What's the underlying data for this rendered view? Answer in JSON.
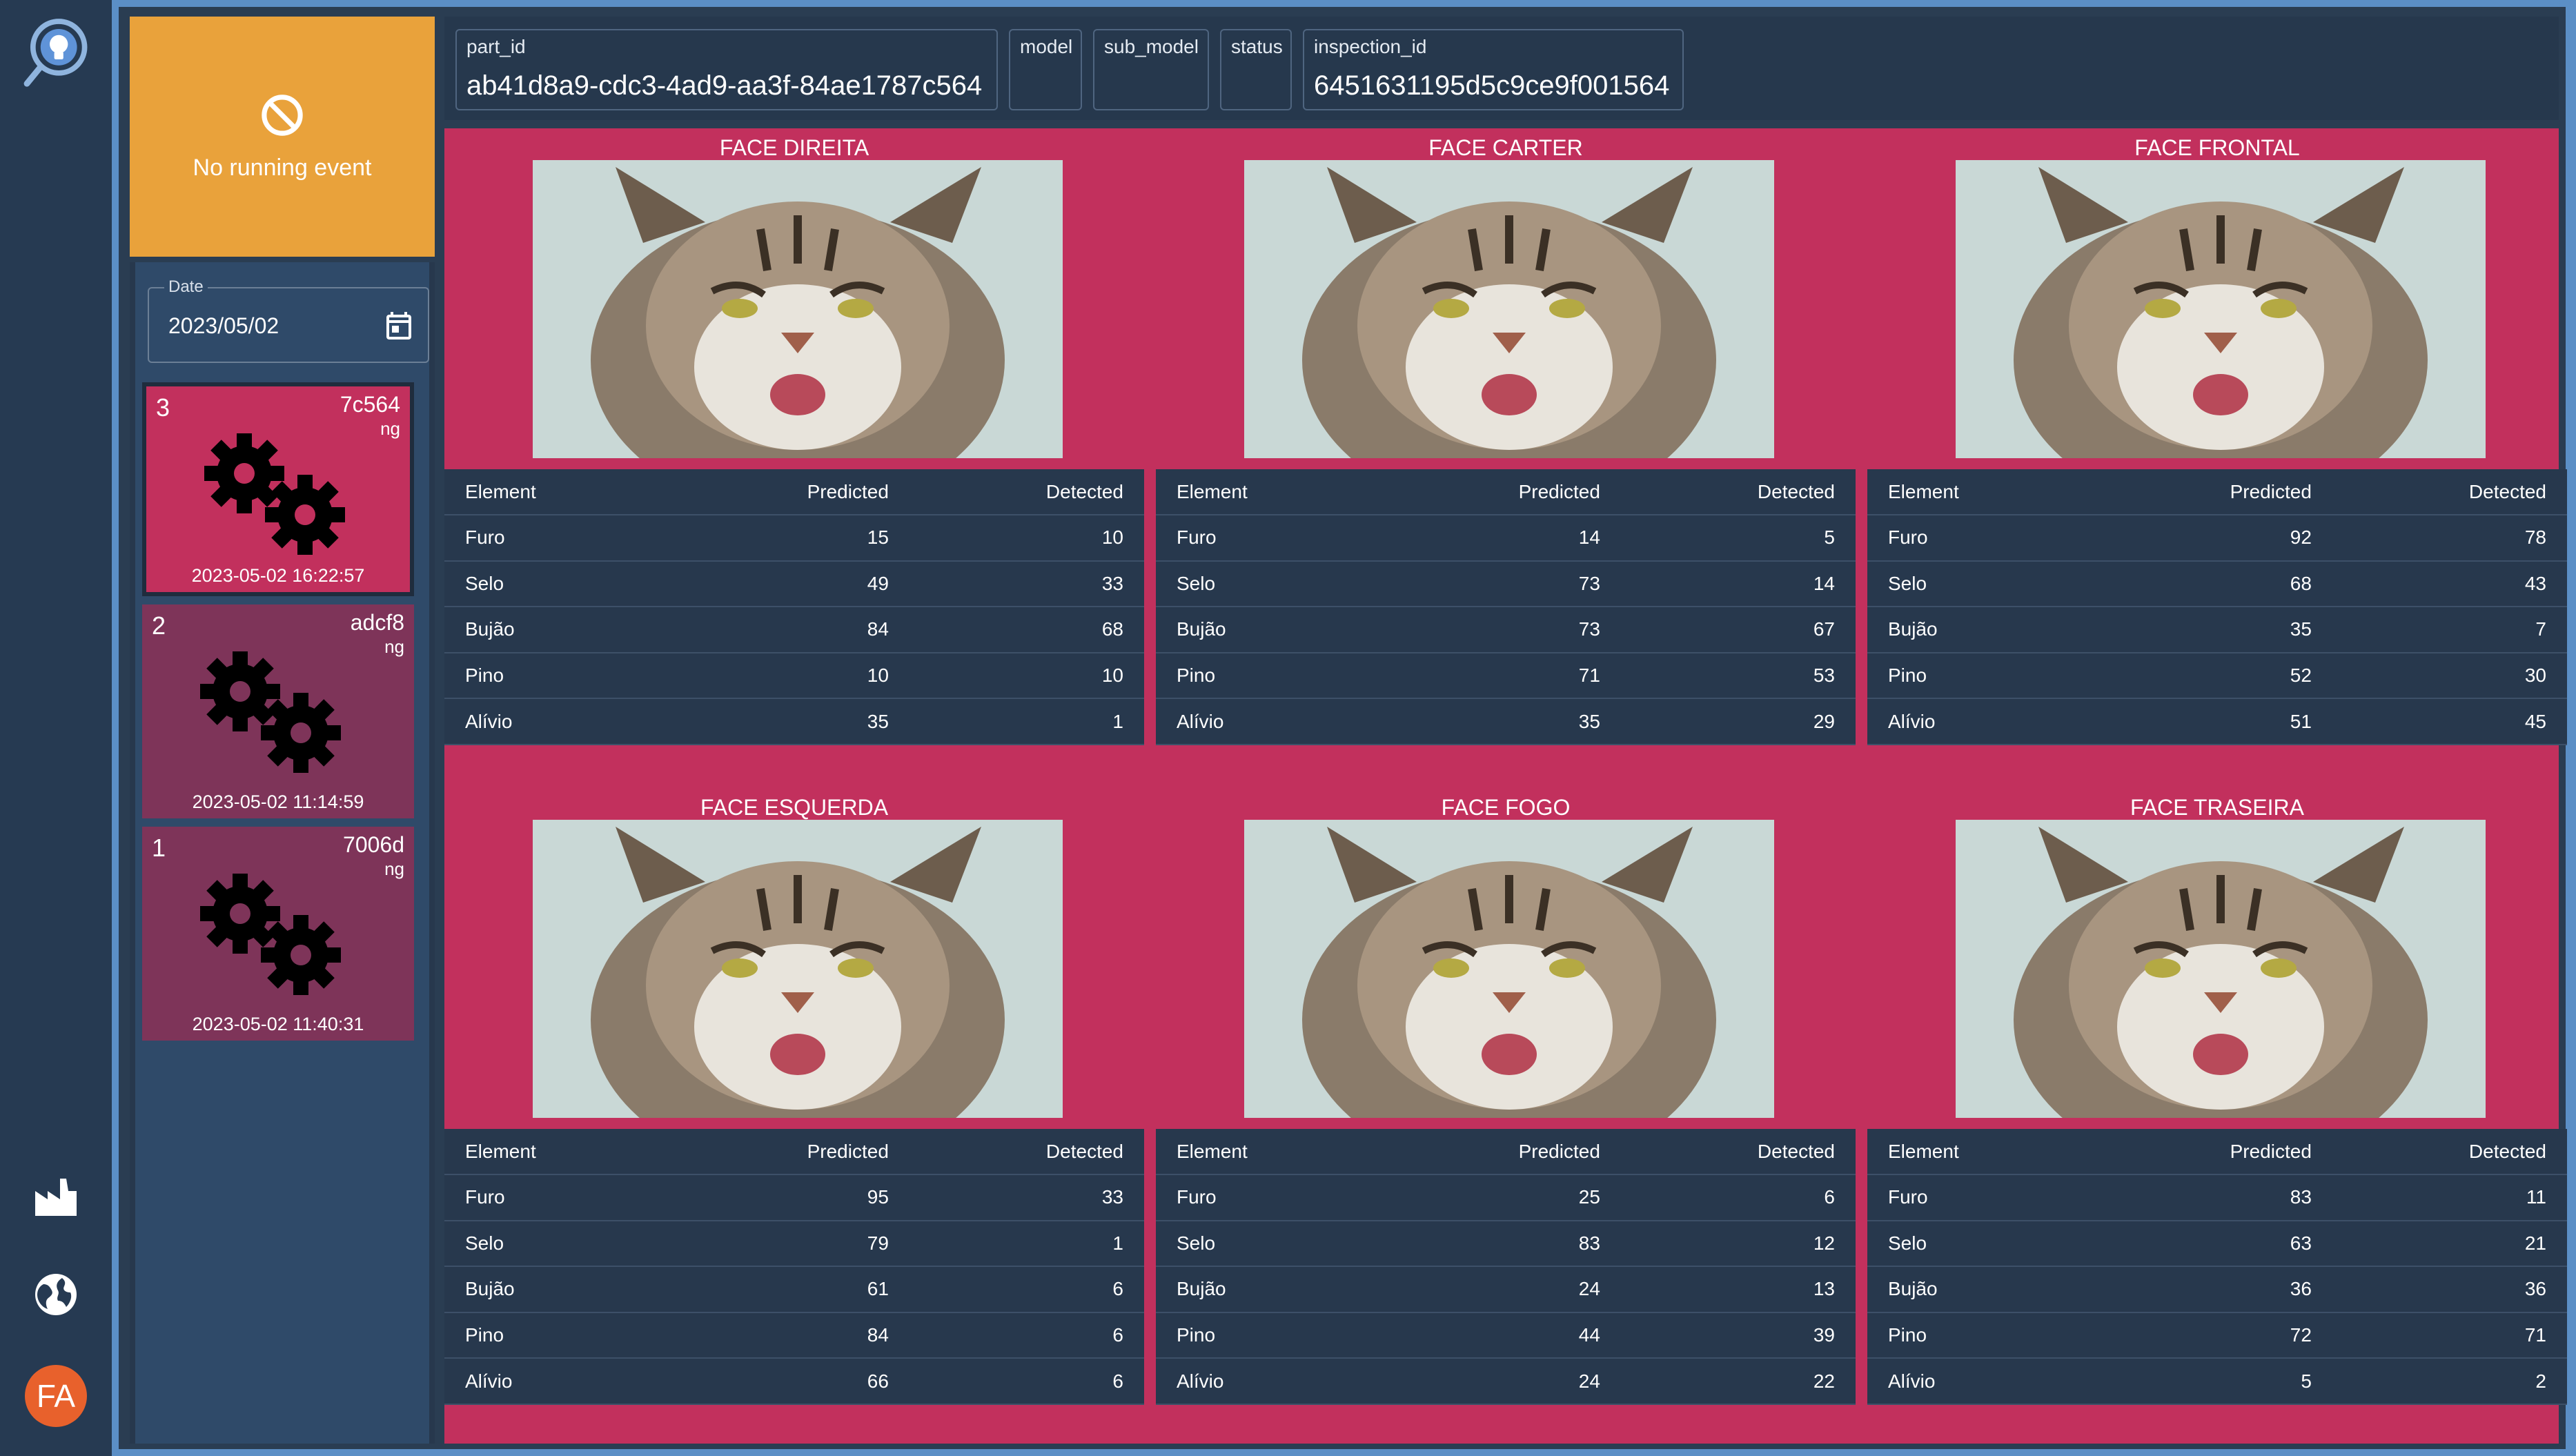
{
  "nav": {
    "avatar_initials": "FA",
    "icons": [
      "app-logo-icon",
      "factory-icon",
      "globe-icon"
    ]
  },
  "banner": {
    "icon": "block-icon",
    "text": "No running event",
    "color": "#e9a23b"
  },
  "sidebar": {
    "date_label": "Date",
    "date_value": "2023/05/02",
    "events": [
      {
        "number": "3",
        "part": "7c564",
        "status": "ng",
        "timestamp": "2023-05-02 16:22:57",
        "selected": true
      },
      {
        "number": "2",
        "part": "adcf8",
        "status": "ng",
        "timestamp": "2023-05-02 11:14:59",
        "selected": false
      },
      {
        "number": "1",
        "part": "7006d",
        "status": "ng",
        "timestamp": "2023-05-02 11:40:31",
        "selected": false
      }
    ]
  },
  "header": {
    "part_id_label": "part_id",
    "part_id_value": "ab41d8a9-cdc3-4ad9-aa3f-84ae1787c564",
    "model_label": "model",
    "model_value": "",
    "sub_model_label": "sub_model",
    "sub_model_value": "",
    "status_label": "status",
    "status_value": "",
    "inspection_id_label": "inspection_id",
    "inspection_id_value": "6451631195d5c9ce9f001564"
  },
  "table_columns": [
    "Element",
    "Predicted",
    "Detected"
  ],
  "panels": [
    {
      "title": "FACE DIREITA",
      "rows": [
        [
          "Furo",
          "15",
          "10"
        ],
        [
          "Selo",
          "49",
          "33"
        ],
        [
          "Bujão",
          "84",
          "68"
        ],
        [
          "Pino",
          "10",
          "10"
        ],
        [
          "Alívio",
          "35",
          "1"
        ]
      ]
    },
    {
      "title": "FACE CARTER",
      "rows": [
        [
          "Furo",
          "14",
          "5"
        ],
        [
          "Selo",
          "73",
          "14"
        ],
        [
          "Bujão",
          "73",
          "67"
        ],
        [
          "Pino",
          "71",
          "53"
        ],
        [
          "Alívio",
          "35",
          "29"
        ]
      ]
    },
    {
      "title": "FACE FRONTAL",
      "rows": [
        [
          "Furo",
          "92",
          "78"
        ],
        [
          "Selo",
          "68",
          "43"
        ],
        [
          "Bujão",
          "35",
          "7"
        ],
        [
          "Pino",
          "52",
          "30"
        ],
        [
          "Alívio",
          "51",
          "45"
        ]
      ]
    },
    {
      "title": "FACE ESQUERDA",
      "rows": [
        [
          "Furo",
          "95",
          "33"
        ],
        [
          "Selo",
          "79",
          "1"
        ],
        [
          "Bujão",
          "61",
          "6"
        ],
        [
          "Pino",
          "84",
          "6"
        ],
        [
          "Alívio",
          "66",
          "6"
        ]
      ]
    },
    {
      "title": "FACE FOGO",
      "rows": [
        [
          "Furo",
          "25",
          "6"
        ],
        [
          "Selo",
          "83",
          "12"
        ],
        [
          "Bujão",
          "24",
          "13"
        ],
        [
          "Pino",
          "44",
          "39"
        ],
        [
          "Alívio",
          "24",
          "22"
        ]
      ]
    },
    {
      "title": "FACE TRASEIRA",
      "rows": [
        [
          "Furo",
          "83",
          "11"
        ],
        [
          "Selo",
          "63",
          "21"
        ],
        [
          "Bujão",
          "36",
          "36"
        ],
        [
          "Pino",
          "72",
          "71"
        ],
        [
          "Alívio",
          "5",
          "2"
        ]
      ]
    }
  ],
  "colors": {
    "ng_selected": "#c2305d",
    "ng_card": "#7e3459",
    "panel_bg": "#c2305d",
    "accent_avatar": "#e8612c"
  }
}
